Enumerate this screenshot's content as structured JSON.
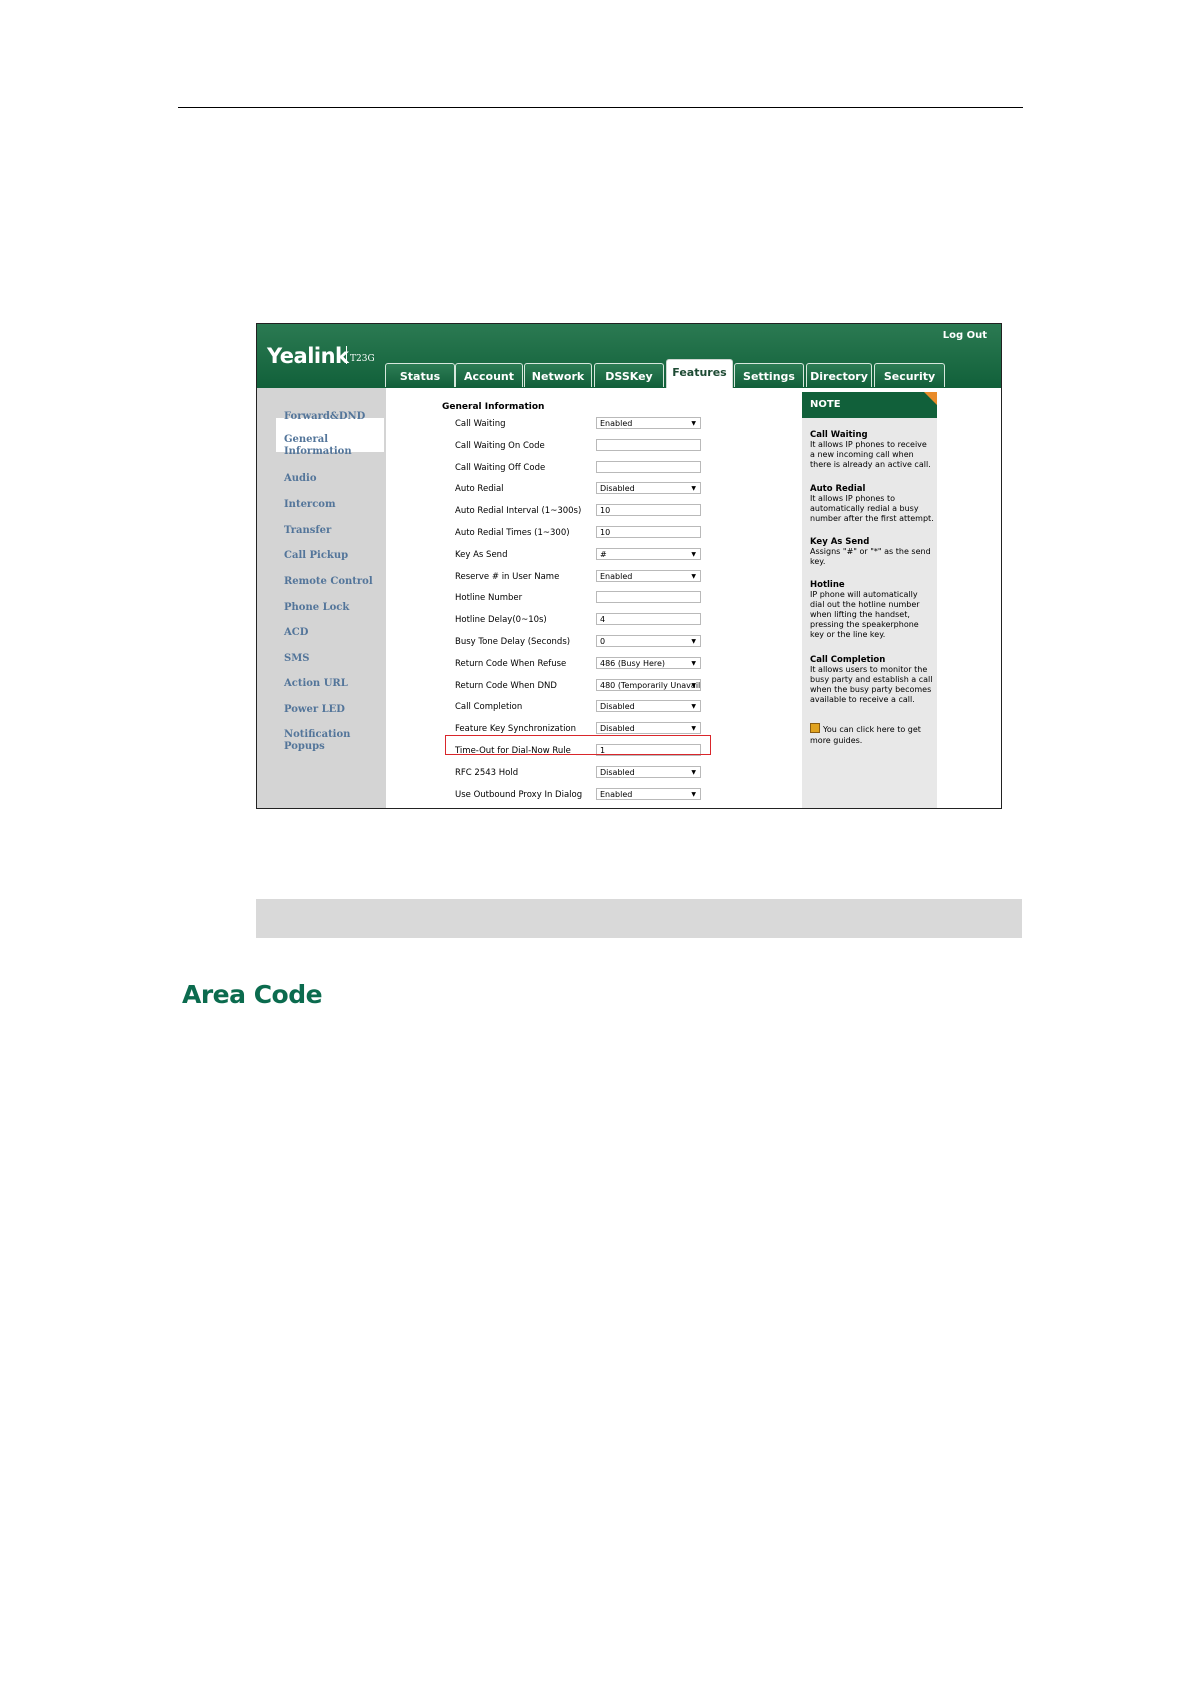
{
  "screenshot": {
    "logo": "Yealink",
    "model": "T23G",
    "logout": "Log Out",
    "tabs": [
      {
        "label": "Status",
        "active": false
      },
      {
        "label": "Account",
        "active": false
      },
      {
        "label": "Network",
        "active": false
      },
      {
        "label": "DSSKey",
        "active": false
      },
      {
        "label": "Features",
        "active": true
      },
      {
        "label": "Settings",
        "active": false
      },
      {
        "label": "Directory",
        "active": false
      },
      {
        "label": "Security",
        "active": false
      }
    ],
    "sidebar": [
      "Forward&DND",
      "General\nInformation",
      "Audio",
      "Intercom",
      "Transfer",
      "Call Pickup",
      "Remote Control",
      "Phone Lock",
      "ACD",
      "SMS",
      "Action URL",
      "Power LED",
      "Notification Popups"
    ],
    "section_title": "General Information",
    "rows": [
      {
        "label": "Call Waiting",
        "value": "Enabled",
        "type": "select"
      },
      {
        "label": "Call Waiting On Code",
        "value": "",
        "type": "text"
      },
      {
        "label": "Call Waiting Off Code",
        "value": "",
        "type": "text"
      },
      {
        "label": "Auto Redial",
        "value": "Disabled",
        "type": "select"
      },
      {
        "label": "Auto Redial Interval (1~300s)",
        "value": "10",
        "type": "text"
      },
      {
        "label": "Auto Redial Times (1~300)",
        "value": "10",
        "type": "text"
      },
      {
        "label": "Key As Send",
        "value": "#",
        "type": "select"
      },
      {
        "label": "Reserve # in User Name",
        "value": "Enabled",
        "type": "select"
      },
      {
        "label": "Hotline Number",
        "value": "",
        "type": "text"
      },
      {
        "label": "Hotline Delay(0~10s)",
        "value": "4",
        "type": "text"
      },
      {
        "label": "Busy Tone Delay (Seconds)",
        "value": "0",
        "type": "select"
      },
      {
        "label": "Return Code When Refuse",
        "value": "486 (Busy Here)",
        "type": "select"
      },
      {
        "label": "Return Code When DND",
        "value": "480 (Temporarily Unavail",
        "type": "select"
      },
      {
        "label": "Call Completion",
        "value": "Disabled",
        "type": "select"
      },
      {
        "label": "Feature Key Synchronization",
        "value": "Disabled",
        "type": "select"
      },
      {
        "label": "Time-Out for Dial-Now Rule",
        "value": "1",
        "type": "text"
      },
      {
        "label": "RFC 2543 Hold",
        "value": "Disabled",
        "type": "select"
      },
      {
        "label": "Use Outbound Proxy In Dialog",
        "value": "Enabled",
        "type": "select"
      }
    ],
    "note": {
      "title": "NOTE",
      "items": [
        {
          "title": "Call Waiting",
          "text": "It allows IP phones to receive a new incoming call when there is already an active call."
        },
        {
          "title": "Auto Redial",
          "text": "It allows IP phones to automatically redial a busy number after the first attempt."
        },
        {
          "title": "Key As Send",
          "text": "Assigns \"#\" or \"*\" as the send key."
        },
        {
          "title": "Hotline",
          "text": "IP phone will automatically dial out the hotline number when lifting the handset, pressing the speakerphone key or the line key."
        },
        {
          "title": "Call Completion",
          "text": "It allows users to monitor the busy party and establish a call when the busy party becomes available to receive a call."
        }
      ],
      "guide": "You can click here to get more guides."
    }
  },
  "heading": "Area Code"
}
